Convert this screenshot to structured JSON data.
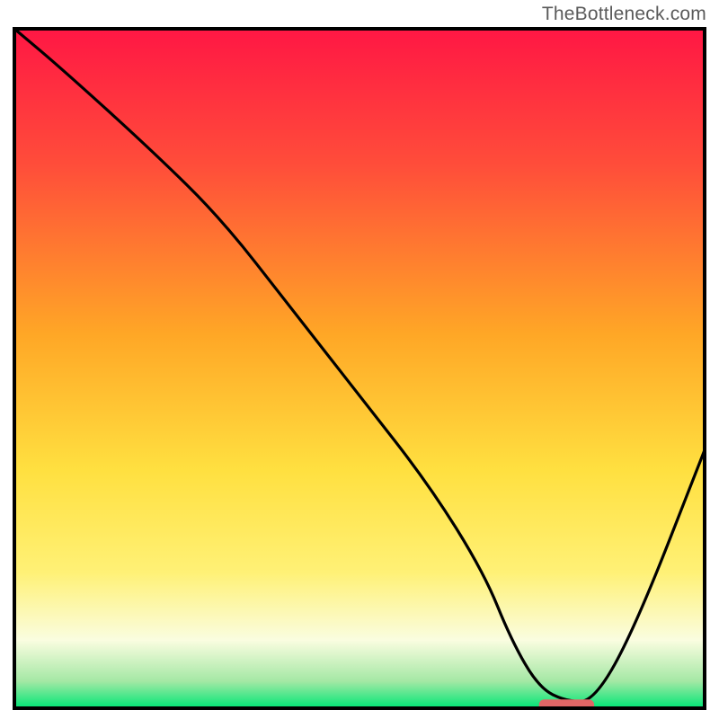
{
  "watermark": "TheBottleneck.com",
  "chart_data": {
    "type": "line",
    "title": "",
    "xlabel": "",
    "ylabel": "",
    "xlim": [
      0,
      100
    ],
    "ylim": [
      0,
      100
    ],
    "gradient_stops": [
      {
        "offset": 0,
        "color": "#ff1744"
      },
      {
        "offset": 20,
        "color": "#ff4d3a"
      },
      {
        "offset": 45,
        "color": "#ffa726"
      },
      {
        "offset": 65,
        "color": "#ffe040"
      },
      {
        "offset": 80,
        "color": "#fff176"
      },
      {
        "offset": 90,
        "color": "#fafde0"
      },
      {
        "offset": 96,
        "color": "#a5e8a5"
      },
      {
        "offset": 100,
        "color": "#00e676"
      }
    ],
    "series": [
      {
        "name": "bottleneck-curve",
        "x": [
          0,
          7,
          20,
          30,
          40,
          50,
          60,
          68,
          72,
          76,
          80,
          84,
          90,
          100
        ],
        "y": [
          100,
          94,
          82,
          72,
          59,
          46,
          33,
          20,
          10,
          3,
          1,
          1,
          12,
          38
        ]
      }
    ],
    "marker": {
      "name": "optimal-range",
      "x_start": 76,
      "x_end": 84,
      "y": 0.5,
      "color": "#e06666"
    },
    "frame_color": "#000000"
  }
}
